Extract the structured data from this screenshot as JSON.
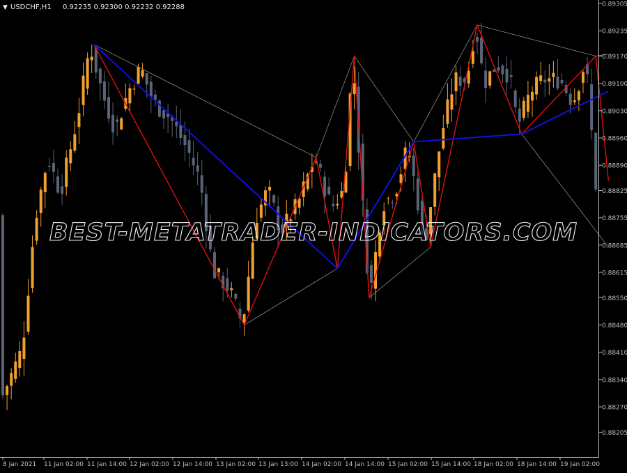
{
  "header": {
    "marker": "▼",
    "symbol": "USDCHF,H1",
    "ohlc": "0.92235 0.92300 0.92232 0.92288"
  },
  "watermark": "BEST-METATRADER-INDICATORS.COM",
  "colors": {
    "background": "#000000",
    "axis": "#c0c0c0",
    "bull": "#f0a030",
    "bear": "#5a6478",
    "zigzag_red": "#e01010",
    "zigzag_blue": "#1010e0",
    "envelope": "#8a8a8a",
    "watermark": "#f0f0f0"
  },
  "chart_data": {
    "type": "candlestick",
    "price_range": [
      0.8817,
      0.89305
    ],
    "y_ticks": [
      "0.89305",
      "0.89235",
      "0.89170",
      "0.89100",
      "0.89030",
      "0.88960",
      "0.88890",
      "0.88825",
      "0.88755",
      "0.88685",
      "0.88615",
      "0.88550",
      "0.88480",
      "0.88410",
      "0.88340",
      "0.88270",
      "0.88205"
    ],
    "x_ticks": [
      "8 Jan 2021",
      "11 Jan 02:00",
      "11 Jan 14:00",
      "12 Jan 02:00",
      "12 Jan 14:00",
      "13 Jan 02:00",
      "13 Jan 13:00",
      "14 Jan 02:00",
      "14 Jan 14:00",
      "15 Jan 02:00",
      "15 Jan 14:00",
      "18 Jan 02:00",
      "18 Jan 14:00",
      "19 Jan 02:00"
    ],
    "bar_count": 141,
    "anchors": [
      [
        0,
        0.8829
      ],
      [
        5,
        0.8842
      ],
      [
        8,
        0.8875
      ],
      [
        11,
        0.8891
      ],
      [
        14,
        0.8882
      ],
      [
        18,
        0.8901
      ],
      [
        21,
        0.892
      ],
      [
        24,
        0.8907
      ],
      [
        27,
        0.8898
      ],
      [
        30,
        0.8908
      ],
      [
        33,
        0.8914
      ],
      [
        36,
        0.8905
      ],
      [
        40,
        0.8901
      ],
      [
        44,
        0.8893
      ],
      [
        47,
        0.8885
      ],
      [
        50,
        0.8862
      ],
      [
        54,
        0.8857
      ],
      [
        57,
        0.8848
      ],
      [
        60,
        0.8875
      ],
      [
        63,
        0.8883
      ],
      [
        66,
        0.8872
      ],
      [
        70,
        0.8879
      ],
      [
        74,
        0.8891
      ],
      [
        78,
        0.8878
      ],
      [
        81,
        0.8883
      ],
      [
        83,
        0.8917
      ],
      [
        85,
        0.8884
      ],
      [
        87,
        0.8855
      ],
      [
        90,
        0.8879
      ],
      [
        93,
        0.8882
      ],
      [
        96,
        0.8894
      ],
      [
        98,
        0.8882
      ],
      [
        100,
        0.8869
      ],
      [
        102,
        0.8883
      ],
      [
        104,
        0.8897
      ],
      [
        107,
        0.8911
      ],
      [
        110,
        0.8911
      ],
      [
        112,
        0.8925
      ],
      [
        114,
        0.891
      ],
      [
        117,
        0.8915
      ],
      [
        120,
        0.8912
      ],
      [
        122,
        0.8899
      ],
      [
        125,
        0.8908
      ],
      [
        128,
        0.8911
      ],
      [
        132,
        0.8911
      ],
      [
        135,
        0.8905
      ],
      [
        138,
        0.8916
      ],
      [
        141,
        0.8876
      ]
    ],
    "zigzag_red": [
      [
        21.5,
        0.892
      ],
      [
        57,
        0.8848
      ],
      [
        74,
        0.8891
      ],
      [
        79,
        0.88625
      ],
      [
        83,
        0.8917
      ],
      [
        86.5,
        0.8855
      ],
      [
        97,
        0.8895
      ],
      [
        101,
        0.8868
      ],
      [
        112,
        0.8925
      ],
      [
        122.5,
        0.8897
      ],
      [
        140,
        0.8917
      ],
      [
        143,
        0.8885
      ]
    ],
    "zigzag_blue": [
      [
        21.5,
        0.892
      ],
      [
        79,
        0.88625
      ],
      [
        97,
        0.8895
      ],
      [
        122.5,
        0.8897
      ],
      [
        143,
        0.8908
      ]
    ],
    "envelope_upper": [
      [
        21.5,
        0.892
      ],
      [
        74,
        0.8891
      ],
      [
        83,
        0.8917
      ],
      [
        97,
        0.8895
      ],
      [
        112,
        0.8925
      ],
      [
        140,
        0.8917
      ],
      [
        143,
        0.89175
      ]
    ],
    "envelope_lower": [
      [
        57,
        0.8848
      ],
      [
        79,
        0.88625
      ],
      [
        83,
        0.8917
      ],
      [
        86.5,
        0.8855
      ],
      [
        101,
        0.8868
      ],
      [
        112,
        0.8925
      ],
      [
        122.5,
        0.8897
      ],
      [
        143,
        0.8868
      ]
    ]
  }
}
